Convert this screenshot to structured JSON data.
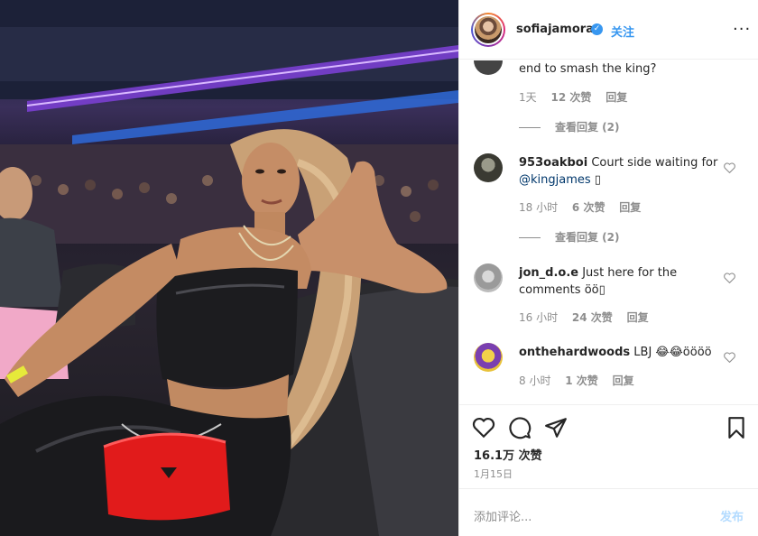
{
  "post": {
    "username": "sofiajamora",
    "verified_badge": "✓",
    "follow_label": "关注",
    "more_icon": "more-horizontal-icon"
  },
  "comments": [
    {
      "text": "end to smash the king?",
      "time": "1天",
      "likes": "12 次赞",
      "reply": "回复",
      "view_replies": "查看回复 (2)"
    },
    {
      "username": "953oakboi",
      "text": "Court side waiting for",
      "mention": "@kingjames",
      "emoji": "▯",
      "time": "18 小时",
      "likes": "6 次赞",
      "reply": "回复",
      "view_replies": "查看回复 (2)"
    },
    {
      "username": "jon_d.o.e",
      "text": "Just here for the comments",
      "emoji": "öö▯",
      "time": "16 小时",
      "likes": "24 次赞",
      "reply": "回复"
    },
    {
      "username": "onthehardwoods",
      "text": "LBJ",
      "emoji": "😂😂öööö",
      "time": "8 小时",
      "likes": "1 次赞",
      "reply": "回复"
    }
  ],
  "actions": {
    "like_count": "16.1万 次赞",
    "date": "1月15日"
  },
  "comment_box": {
    "placeholder": "添加评论...",
    "post_label": "发布"
  },
  "colors": {
    "link_blue": "#3897f0",
    "muted": "#8e8e8e",
    "mention": "#00376b"
  }
}
